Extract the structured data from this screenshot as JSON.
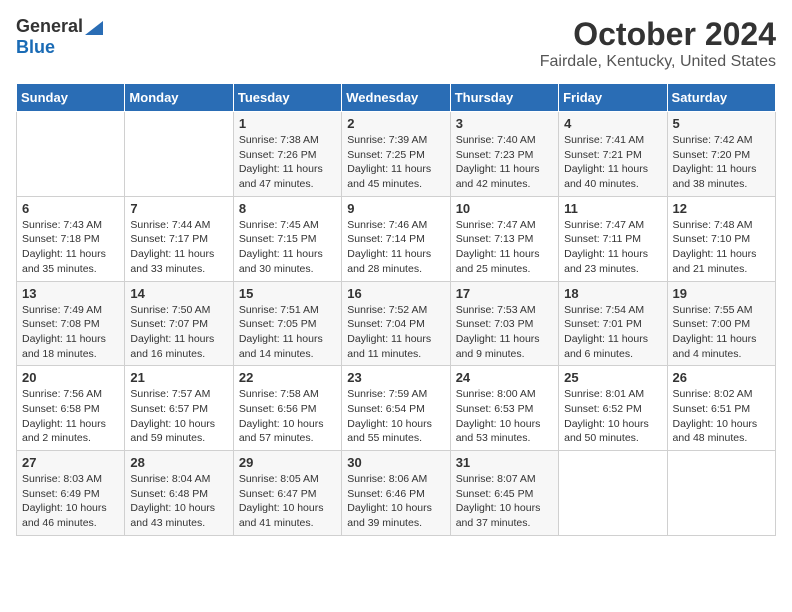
{
  "logo": {
    "general": "General",
    "blue": "Blue"
  },
  "title": "October 2024",
  "subtitle": "Fairdale, Kentucky, United States",
  "weekdays": [
    "Sunday",
    "Monday",
    "Tuesday",
    "Wednesday",
    "Thursday",
    "Friday",
    "Saturday"
  ],
  "weeks": [
    [
      null,
      null,
      {
        "day": 1,
        "sunrise": "Sunrise: 7:38 AM",
        "sunset": "Sunset: 7:26 PM",
        "daylight": "Daylight: 11 hours and 47 minutes."
      },
      {
        "day": 2,
        "sunrise": "Sunrise: 7:39 AM",
        "sunset": "Sunset: 7:25 PM",
        "daylight": "Daylight: 11 hours and 45 minutes."
      },
      {
        "day": 3,
        "sunrise": "Sunrise: 7:40 AM",
        "sunset": "Sunset: 7:23 PM",
        "daylight": "Daylight: 11 hours and 42 minutes."
      },
      {
        "day": 4,
        "sunrise": "Sunrise: 7:41 AM",
        "sunset": "Sunset: 7:21 PM",
        "daylight": "Daylight: 11 hours and 40 minutes."
      },
      {
        "day": 5,
        "sunrise": "Sunrise: 7:42 AM",
        "sunset": "Sunset: 7:20 PM",
        "daylight": "Daylight: 11 hours and 38 minutes."
      }
    ],
    [
      {
        "day": 6,
        "sunrise": "Sunrise: 7:43 AM",
        "sunset": "Sunset: 7:18 PM",
        "daylight": "Daylight: 11 hours and 35 minutes."
      },
      {
        "day": 7,
        "sunrise": "Sunrise: 7:44 AM",
        "sunset": "Sunset: 7:17 PM",
        "daylight": "Daylight: 11 hours and 33 minutes."
      },
      {
        "day": 8,
        "sunrise": "Sunrise: 7:45 AM",
        "sunset": "Sunset: 7:15 PM",
        "daylight": "Daylight: 11 hours and 30 minutes."
      },
      {
        "day": 9,
        "sunrise": "Sunrise: 7:46 AM",
        "sunset": "Sunset: 7:14 PM",
        "daylight": "Daylight: 11 hours and 28 minutes."
      },
      {
        "day": 10,
        "sunrise": "Sunrise: 7:47 AM",
        "sunset": "Sunset: 7:13 PM",
        "daylight": "Daylight: 11 hours and 25 minutes."
      },
      {
        "day": 11,
        "sunrise": "Sunrise: 7:47 AM",
        "sunset": "Sunset: 7:11 PM",
        "daylight": "Daylight: 11 hours and 23 minutes."
      },
      {
        "day": 12,
        "sunrise": "Sunrise: 7:48 AM",
        "sunset": "Sunset: 7:10 PM",
        "daylight": "Daylight: 11 hours and 21 minutes."
      }
    ],
    [
      {
        "day": 13,
        "sunrise": "Sunrise: 7:49 AM",
        "sunset": "Sunset: 7:08 PM",
        "daylight": "Daylight: 11 hours and 18 minutes."
      },
      {
        "day": 14,
        "sunrise": "Sunrise: 7:50 AM",
        "sunset": "Sunset: 7:07 PM",
        "daylight": "Daylight: 11 hours and 16 minutes."
      },
      {
        "day": 15,
        "sunrise": "Sunrise: 7:51 AM",
        "sunset": "Sunset: 7:05 PM",
        "daylight": "Daylight: 11 hours and 14 minutes."
      },
      {
        "day": 16,
        "sunrise": "Sunrise: 7:52 AM",
        "sunset": "Sunset: 7:04 PM",
        "daylight": "Daylight: 11 hours and 11 minutes."
      },
      {
        "day": 17,
        "sunrise": "Sunrise: 7:53 AM",
        "sunset": "Sunset: 7:03 PM",
        "daylight": "Daylight: 11 hours and 9 minutes."
      },
      {
        "day": 18,
        "sunrise": "Sunrise: 7:54 AM",
        "sunset": "Sunset: 7:01 PM",
        "daylight": "Daylight: 11 hours and 6 minutes."
      },
      {
        "day": 19,
        "sunrise": "Sunrise: 7:55 AM",
        "sunset": "Sunset: 7:00 PM",
        "daylight": "Daylight: 11 hours and 4 minutes."
      }
    ],
    [
      {
        "day": 20,
        "sunrise": "Sunrise: 7:56 AM",
        "sunset": "Sunset: 6:58 PM",
        "daylight": "Daylight: 11 hours and 2 minutes."
      },
      {
        "day": 21,
        "sunrise": "Sunrise: 7:57 AM",
        "sunset": "Sunset: 6:57 PM",
        "daylight": "Daylight: 10 hours and 59 minutes."
      },
      {
        "day": 22,
        "sunrise": "Sunrise: 7:58 AM",
        "sunset": "Sunset: 6:56 PM",
        "daylight": "Daylight: 10 hours and 57 minutes."
      },
      {
        "day": 23,
        "sunrise": "Sunrise: 7:59 AM",
        "sunset": "Sunset: 6:54 PM",
        "daylight": "Daylight: 10 hours and 55 minutes."
      },
      {
        "day": 24,
        "sunrise": "Sunrise: 8:00 AM",
        "sunset": "Sunset: 6:53 PM",
        "daylight": "Daylight: 10 hours and 53 minutes."
      },
      {
        "day": 25,
        "sunrise": "Sunrise: 8:01 AM",
        "sunset": "Sunset: 6:52 PM",
        "daylight": "Daylight: 10 hours and 50 minutes."
      },
      {
        "day": 26,
        "sunrise": "Sunrise: 8:02 AM",
        "sunset": "Sunset: 6:51 PM",
        "daylight": "Daylight: 10 hours and 48 minutes."
      }
    ],
    [
      {
        "day": 27,
        "sunrise": "Sunrise: 8:03 AM",
        "sunset": "Sunset: 6:49 PM",
        "daylight": "Daylight: 10 hours and 46 minutes."
      },
      {
        "day": 28,
        "sunrise": "Sunrise: 8:04 AM",
        "sunset": "Sunset: 6:48 PM",
        "daylight": "Daylight: 10 hours and 43 minutes."
      },
      {
        "day": 29,
        "sunrise": "Sunrise: 8:05 AM",
        "sunset": "Sunset: 6:47 PM",
        "daylight": "Daylight: 10 hours and 41 minutes."
      },
      {
        "day": 30,
        "sunrise": "Sunrise: 8:06 AM",
        "sunset": "Sunset: 6:46 PM",
        "daylight": "Daylight: 10 hours and 39 minutes."
      },
      {
        "day": 31,
        "sunrise": "Sunrise: 8:07 AM",
        "sunset": "Sunset: 6:45 PM",
        "daylight": "Daylight: 10 hours and 37 minutes."
      },
      null,
      null
    ]
  ]
}
